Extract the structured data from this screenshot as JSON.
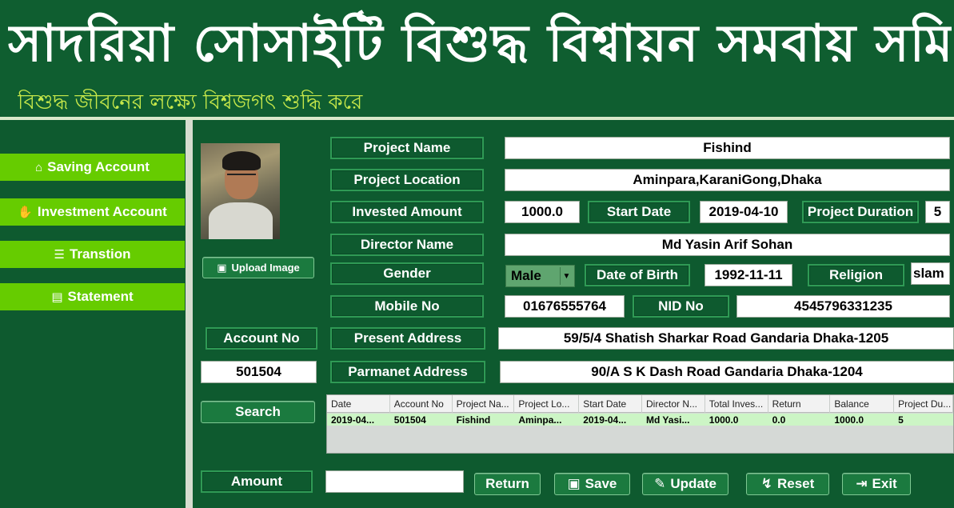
{
  "header": {
    "title": "সাদরিয়া সোসাইটি বিশুদ্ধ বিশ্বায়ন সমবায় সমিতি",
    "subtitle": "বিশুদ্ধ জীবনের লক্ষ্যে বিশ্বজগৎ শুদ্ধি করে"
  },
  "sidebar": {
    "items": [
      {
        "label": "Saving Account",
        "icon": "bank-icon"
      },
      {
        "label": "Investment Account",
        "icon": "hand-coin-icon"
      },
      {
        "label": "Transtion",
        "icon": "receipt-icon"
      },
      {
        "label": "Statement",
        "icon": "document-icon"
      }
    ]
  },
  "form": {
    "project_name_label": "Project Name",
    "project_name_value": "Fishind",
    "project_location_label": "Project Location",
    "project_location_value": "Aminpara,KaraniGong,Dhaka",
    "invested_amount_label": "Invested Amount",
    "invested_amount_value": "1000.0",
    "start_date_label": "Start Date",
    "start_date_value": "2019-04-10",
    "project_duration_label": "Project Duration",
    "project_duration_value": "5",
    "director_name_label": "Director Name",
    "director_name_value": "Md Yasin Arif Sohan",
    "gender_label": "Gender",
    "gender_value": "Male",
    "dob_label": "Date of Birth",
    "dob_value": "1992-11-11",
    "religion_label": "Religion",
    "religion_value": "slam",
    "mobile_label": "Mobile No",
    "mobile_value": "01676555764",
    "nid_label": "NID No",
    "nid_value": "4545796331235",
    "account_no_label": "Account  No",
    "account_no_value": "501504",
    "present_address_label": "Present Address",
    "present_address_value": "59/5/4 Shatish Sharkar Road Gandaria Dhaka-1205",
    "parmanet_address_label": "Parmanet  Address",
    "parmanet_address_value": "90/A S K Dash Road Gandaria Dhaka-1204",
    "upload_image_label": "Upload Image",
    "search_label": "Search",
    "amount_label": "Amount",
    "amount_value": ""
  },
  "table": {
    "headers": [
      "Date",
      "Account No",
      "Project Na...",
      "Project Lo...",
      "Start Date",
      "Director N...",
      "Total Inves...",
      "Return",
      "Balance",
      "Project Du..."
    ],
    "rows": [
      [
        "2019-04...",
        "501504",
        "Fishind",
        "Aminpa...",
        "2019-04...",
        "Md Yasi...",
        "1000.0",
        "0.0",
        "1000.0",
        "5"
      ]
    ]
  },
  "actions": {
    "return": "Return",
    "save": "Save",
    "update": "Update",
    "reset": "Reset",
    "exit": "Exit"
  },
  "colors": {
    "background": "#0e5a2f",
    "accent_green": "#66cc00",
    "subtitle": "#c7e84a",
    "table_row": "#ccf5c5"
  }
}
